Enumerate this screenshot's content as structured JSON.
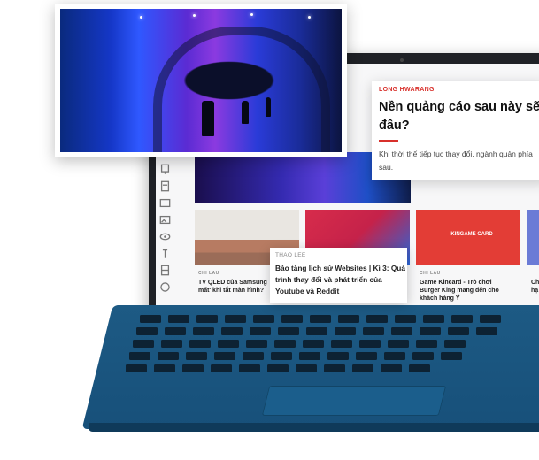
{
  "featured_article": {
    "author": "LONG HWARANG",
    "title": "Nền quảng cáo sau này sẽ đâu?",
    "excerpt": "Khi thời thế tiếp tục thay đổi, ngành quản phía sau."
  },
  "highlight_article": {
    "author": "THAO LEE",
    "title": "Bảo tàng lịch sử Websites | Kì 3: Quá trình thay đổi và phát triển của Youtube và Reddit"
  },
  "screen_cards": [
    {
      "category": "CHI LAU",
      "caption": "TV QLED của Samsung mất' khi tắt màn hình?"
    },
    {
      "category": "CHI LAU",
      "caption": "Game Kincard - Trò chơi Burger King mang đến cho khách hàng Ý"
    },
    {
      "category": "",
      "caption": "Ch hạ"
    }
  ],
  "thumb_label": "KINGAME CARD",
  "rail_icons": [
    "plug-icon",
    "note-icon",
    "card-icon",
    "image-icon",
    "eye-icon",
    "brush-icon",
    "layers-icon",
    "circle-icon"
  ],
  "colors": {
    "accent": "#d8302b",
    "keyboard": "#1d5a84"
  }
}
